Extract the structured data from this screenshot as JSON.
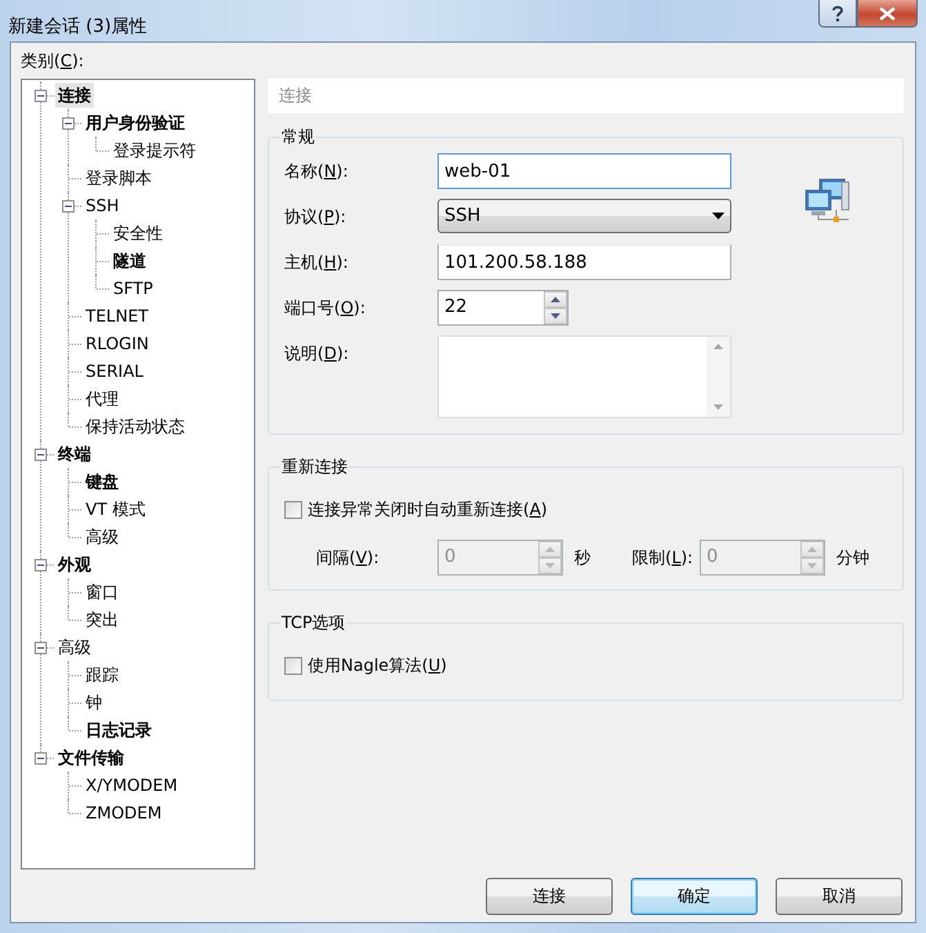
{
  "window": {
    "title": "新建会话 (3)属性"
  },
  "category_label": [
    "类别(",
    "C",
    "):"
  ],
  "tree": [
    {
      "label": "连接",
      "bold": true,
      "selected": true,
      "expanded": true,
      "children": [
        {
          "label": "用户身份验证",
          "bold": true,
          "selected": false,
          "expanded": true,
          "children": [
            {
              "label": "登录提示符",
              "bold": false,
              "selected": false
            }
          ]
        },
        {
          "label": "登录脚本",
          "bold": false,
          "selected": false
        },
        {
          "label": "SSH",
          "bold": false,
          "selected": false,
          "expanded": true,
          "children": [
            {
              "label": "安全性",
              "bold": false,
              "selected": false
            },
            {
              "label": "隧道",
              "bold": true,
              "selected": false
            },
            {
              "label": "SFTP",
              "bold": false,
              "selected": false
            }
          ]
        },
        {
          "label": "TELNET",
          "bold": false,
          "selected": false
        },
        {
          "label": "RLOGIN",
          "bold": false,
          "selected": false
        },
        {
          "label": "SERIAL",
          "bold": false,
          "selected": false
        },
        {
          "label": "代理",
          "bold": false,
          "selected": false
        },
        {
          "label": "保持活动状态",
          "bold": false,
          "selected": false
        }
      ]
    },
    {
      "label": "终端",
      "bold": true,
      "selected": false,
      "expanded": true,
      "children": [
        {
          "label": "键盘",
          "bold": true,
          "selected": false
        },
        {
          "label": "VT 模式",
          "bold": false,
          "selected": false
        },
        {
          "label": "高级",
          "bold": false,
          "selected": false
        }
      ]
    },
    {
      "label": "外观",
      "bold": true,
      "selected": false,
      "expanded": true,
      "children": [
        {
          "label": "窗口",
          "bold": false,
          "selected": false
        },
        {
          "label": "突出",
          "bold": false,
          "selected": false
        }
      ]
    },
    {
      "label": "高级",
      "bold": false,
      "selected": false,
      "expanded": true,
      "children": [
        {
          "label": "跟踪",
          "bold": false,
          "selected": false
        },
        {
          "label": "钟",
          "bold": false,
          "selected": false
        },
        {
          "label": "日志记录",
          "bold": true,
          "selected": false
        }
      ]
    },
    {
      "label": "文件传输",
      "bold": true,
      "selected": false,
      "expanded": true,
      "children": [
        {
          "label": "X/YMODEM",
          "bold": false,
          "selected": false
        },
        {
          "label": "ZMODEM",
          "bold": false,
          "selected": false
        }
      ]
    }
  ],
  "section_header": "连接",
  "general": {
    "title": "常规",
    "fields": [
      {
        "kind": "text",
        "label": [
          "名称(",
          "N",
          "):"
        ],
        "value": "web-01",
        "focused": true
      },
      {
        "kind": "select",
        "label": [
          "协议(",
          "P",
          "):"
        ],
        "value": "SSH",
        "focused": false
      },
      {
        "kind": "text",
        "label": [
          "主机(",
          "H",
          "):"
        ],
        "value": "101.200.58.188",
        "focused": false
      },
      {
        "kind": "spin",
        "label": [
          "端口号(",
          "O",
          "):"
        ],
        "value": "22",
        "focused": false
      },
      {
        "kind": "textarea",
        "label": [
          "说明(",
          "D",
          "):"
        ],
        "focused": false
      }
    ]
  },
  "reconnect": {
    "title": "重新连接",
    "checkbox": {
      "label": [
        "连接异常关闭时自动重新连接(",
        "A",
        ")"
      ],
      "checked": false
    },
    "interval": {
      "label": [
        "间隔(",
        "V",
        "):"
      ],
      "value": "0",
      "unit": "秒",
      "disabled": true
    },
    "limit": {
      "label": [
        "限制(",
        "L",
        "):"
      ],
      "value": "0",
      "unit": "分钟",
      "disabled": true
    }
  },
  "tcp": {
    "title": "TCP选项",
    "checkbox": {
      "label": [
        "使用Nagle算法(",
        "U",
        ")"
      ],
      "checked": false
    }
  },
  "buttons": [
    {
      "label": "连接",
      "default": false
    },
    {
      "label": "确定",
      "default": true
    },
    {
      "label": "取消",
      "default": false
    }
  ]
}
